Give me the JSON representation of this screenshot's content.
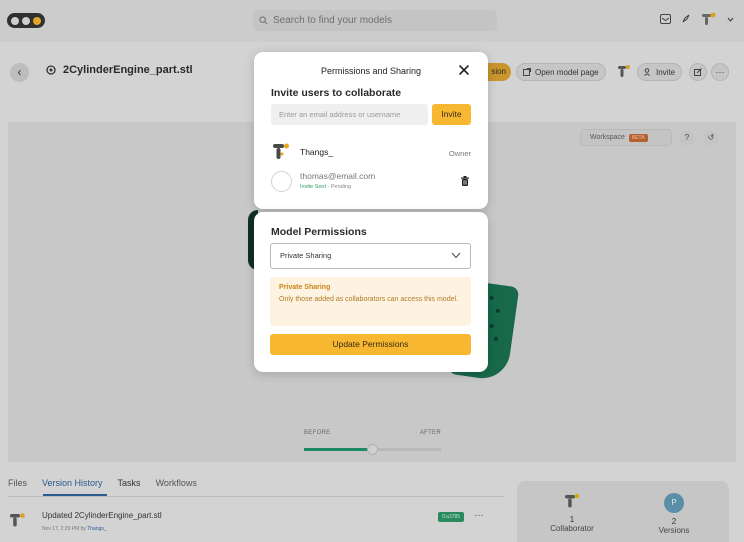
{
  "topbar": {
    "search_placeholder": "Search to find your models"
  },
  "model": {
    "title": "2CylinderEngine_part.stl",
    "permissions_chip": "sion",
    "open_page_label": "Open model page",
    "invite_label": "Invite"
  },
  "viewer": {
    "workspace_label": "Workspace",
    "beta_label": "BETA",
    "help_label": "?",
    "reset_label": "↺",
    "slider": {
      "before_label": "BEFORE",
      "after_label": "AFTER",
      "position": 0.5
    }
  },
  "tabs": [
    "Files",
    "Version History",
    "Tasks",
    "Workflows"
  ],
  "history": {
    "title": "Updated 2CylinderEngine_part.stl",
    "meta_prefix": "Nov 17, 2:29 PM by ",
    "meta_user": "Thangs_",
    "version_badge": "f1a3785",
    "more": "…"
  },
  "stats": {
    "collaborators_count": "1",
    "collaborators_label": "Collaborator",
    "versions_count": "2",
    "versions_label": "Versions",
    "versions_avatar": "P"
  },
  "modal": {
    "title": "Permissions and Sharing",
    "invite_heading": "Invite users to collaborate",
    "invite_placeholder": "Enter an email address or username",
    "invite_button": "Invite",
    "owner": {
      "name": "Thangs_",
      "role": "Owner"
    },
    "pending": {
      "email": "thomas@email.com",
      "status_sent": "Invite Sent",
      "status_rest": " - Pending"
    },
    "permissions_heading": "Model Permissions",
    "permission_selected": "Private Sharing",
    "note_title": "Private Sharing",
    "note_body": "Only those added as collaborators can access this model.",
    "update_button": "Update Permissions"
  },
  "colors": {
    "accent": "#f7b731",
    "success": "#2a9d63",
    "note_bg": "#fdf3e0",
    "link": "#2d5a8f",
    "model_green": "#17694a"
  }
}
